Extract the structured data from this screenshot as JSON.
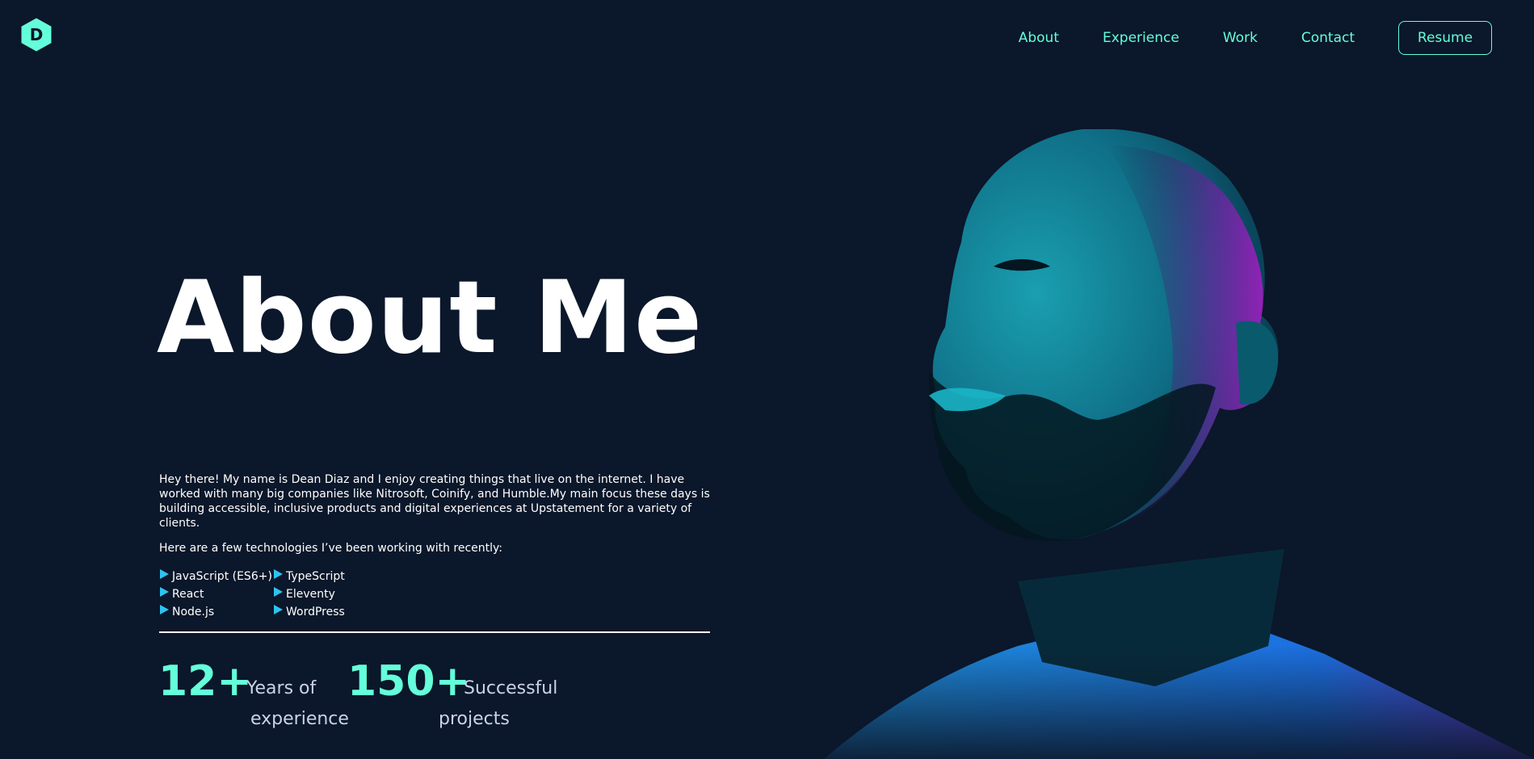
{
  "logo": {
    "letter": "D",
    "icon": "hexagon-logo-icon",
    "color": "#64ffda"
  },
  "nav": {
    "links": [
      "About",
      "Experience",
      "Work",
      "Contact"
    ],
    "resume_label": "Resume"
  },
  "hero": {
    "title": "About Me",
    "intro": "Hey there! My name is Dean Diaz and I enjoy creating things that live on the internet. I have worked with many big companies like Nitrosoft, Coinify, and Humble.My main focus these days is building accessible, inclusive products and digital experiences at Upstatement for a variety of clients.",
    "tech_lead": "Here are a few technologies I’ve been working with recently:",
    "technologies": [
      "JavaScript (ES6+)",
      "TypeScript",
      "React",
      "Eleventy",
      "Node.js",
      "WordPress"
    ]
  },
  "stats": [
    {
      "number": "12+",
      "label_line1": "Years of",
      "label_line2": "experience"
    },
    {
      "number": "150+",
      "label_line1": "Successful",
      "label_line2": "projects"
    }
  ],
  "colors": {
    "background": "#0b172a",
    "accent": "#64ffda",
    "bullet": "#2dc3f0",
    "text": "#ffffff"
  }
}
